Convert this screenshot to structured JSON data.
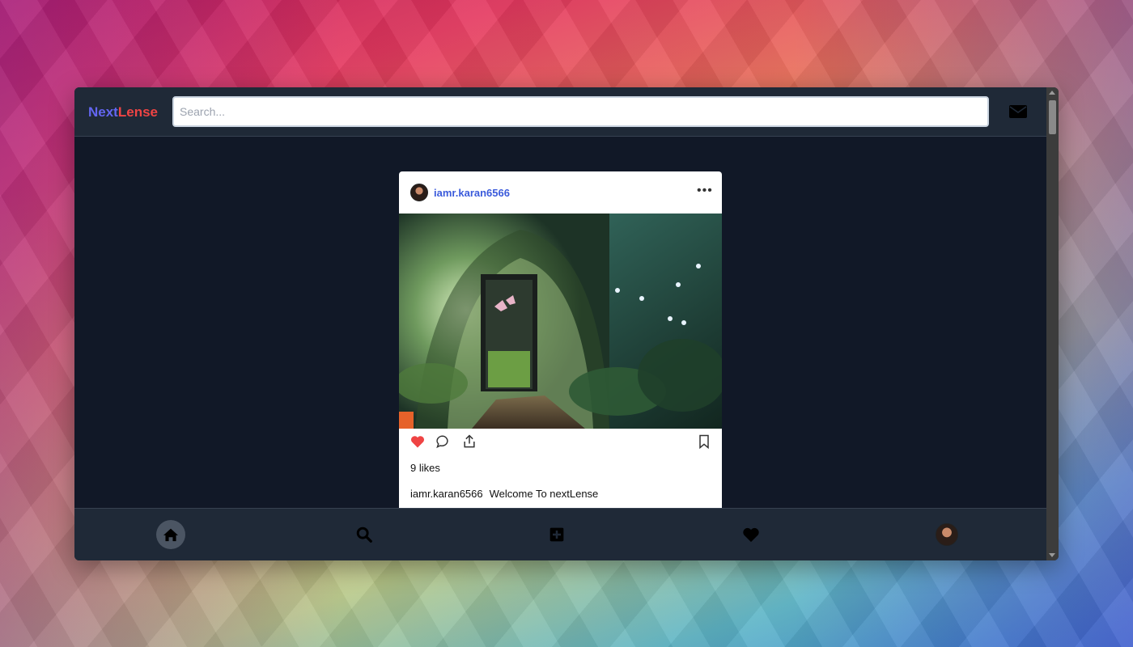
{
  "header": {
    "logo_part1": "Next",
    "logo_part2": "Lense",
    "search_placeholder": "Search...",
    "mail_icon": "envelope-icon"
  },
  "post": {
    "username": "iamr.karan6566",
    "more_icon": "ellipsis-icon",
    "more_label": "•••",
    "image_alt": "Enchanted forest door with butterflies",
    "actions": [
      "heart-icon",
      "comment-icon",
      "share-icon",
      "bookmark-icon"
    ],
    "liked": true,
    "likes_text": "9 likes",
    "caption_user": "iamr.karan6566",
    "caption_text": "Welcome To nextLense"
  },
  "bottom_nav": {
    "items": [
      "home-icon",
      "search-icon",
      "plus-square-icon",
      "heart-icon",
      "profile-avatar"
    ],
    "active": "home"
  },
  "colors": {
    "window_bg": "#111827",
    "bar_bg": "#1f2937",
    "logo_next": "#6366f1",
    "logo_lense": "#ef4444",
    "username": "#3b5bdb",
    "like_red": "#ef4444"
  }
}
